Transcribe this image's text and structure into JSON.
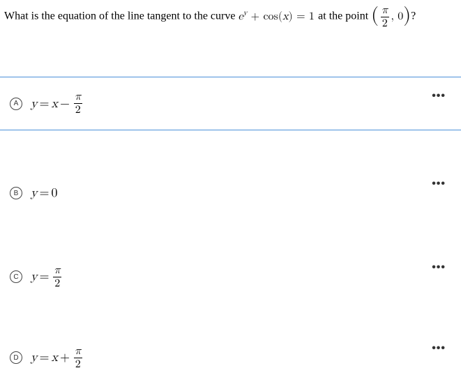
{
  "question": {
    "prefix": "What is the equation of the line tangent to the curve ",
    "curve_lhs_e": "e",
    "curve_lhs_sup": "y",
    "curve_plus": " + cos(",
    "curve_x": "x",
    "curve_close": ") = 1",
    "mid": " at the point ",
    "point_open": "(",
    "point_num": "π",
    "point_den": "2",
    "point_comma": ", 0",
    "point_close": ")",
    "qmark": "?"
  },
  "options": {
    "a": {
      "letter": "A",
      "y": "y",
      "eq": " = ",
      "x": "x",
      "op": " − ",
      "num": "π",
      "den": "2"
    },
    "b": {
      "letter": "B",
      "y": "y",
      "eq": " = ",
      "val": "0"
    },
    "c": {
      "letter": "C",
      "y": "y",
      "eq": " = ",
      "num": "π",
      "den": "2"
    },
    "d": {
      "letter": "D",
      "y": "y",
      "eq": " = ",
      "x": "x",
      "op": " + ",
      "num": "π",
      "den": "2"
    }
  },
  "dots": "•••"
}
